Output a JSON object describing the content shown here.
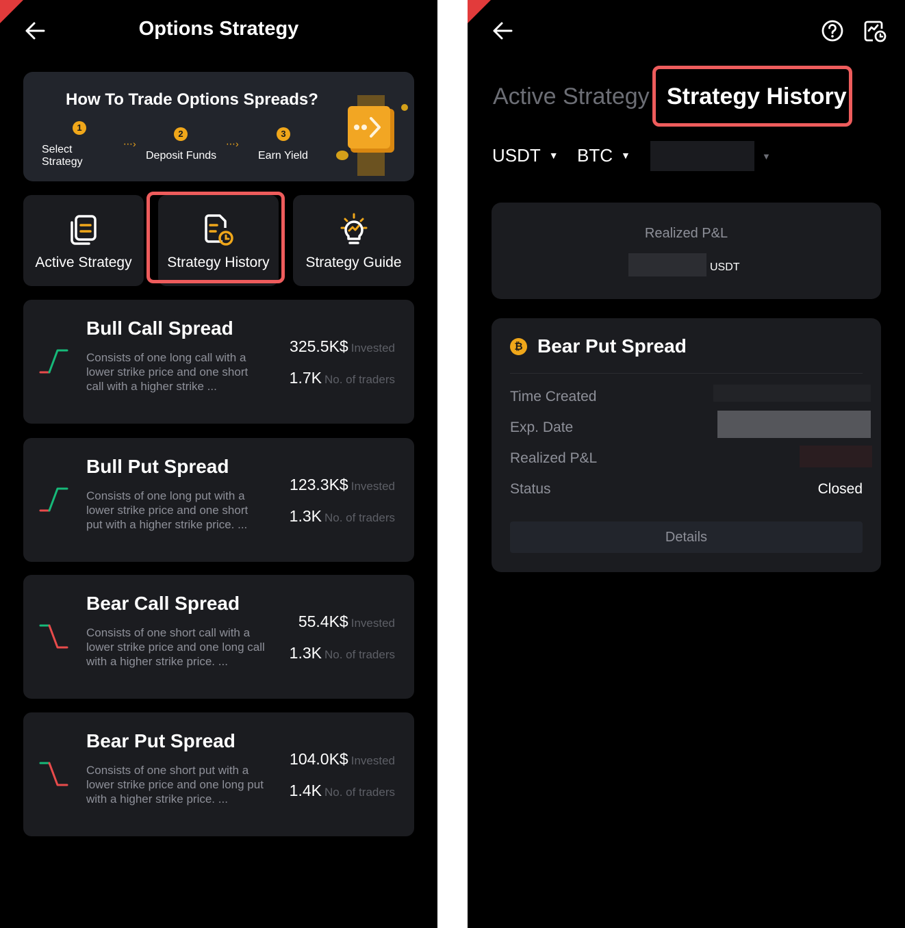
{
  "left_screen": {
    "title": "Options Strategy",
    "banner": {
      "title": "How To Trade Options Spreads?",
      "steps": [
        {
          "number": "1",
          "label": "Select Strategy"
        },
        {
          "number": "2",
          "label": "Deposit Funds"
        },
        {
          "number": "3",
          "label": "Earn Yield"
        }
      ]
    },
    "tiles": [
      {
        "label": "Active Strategy"
      },
      {
        "label": "Strategy History"
      },
      {
        "label": "Strategy Guide"
      }
    ],
    "strategies": [
      {
        "name": "Bull Call Spread",
        "description": "Consists of one long call with a lower strike price and one short call with a higher strike ...",
        "invested": "325.5K$",
        "invested_label": "Invested",
        "traders": "1.7K",
        "traders_label": "No. of traders",
        "trend": "bull"
      },
      {
        "name": "Bull Put Spread",
        "description": "Consists of one long put with a lower strike price and one short put with a higher strike price. ...",
        "invested": "123.3K$",
        "invested_label": "Invested",
        "traders": "1.3K",
        "traders_label": "No. of traders",
        "trend": "bull"
      },
      {
        "name": "Bear Call Spread",
        "description": "Consists of one short call with a lower strike price and one long call with a higher strike price. ...",
        "invested": "55.4K$",
        "invested_label": "Invested",
        "traders": "1.3K",
        "traders_label": "No. of traders",
        "trend": "bear"
      },
      {
        "name": "Bear Put Spread",
        "description": "Consists of one short put with a lower strike price and one long put with a higher strike price. ...",
        "invested": "104.0K$",
        "invested_label": "Invested",
        "traders": "1.4K",
        "traders_label": "No. of traders",
        "trend": "bear"
      }
    ]
  },
  "right_screen": {
    "tabs": {
      "inactive": "Active Strategy",
      "active": "Strategy History"
    },
    "filters": {
      "currency": "USDT",
      "coin": "BTC"
    },
    "summary": {
      "label": "Realized P&L",
      "unit": "USDT"
    },
    "position": {
      "coin_symbol": "₿",
      "name": "Bear Put Spread",
      "rows": {
        "time_created": "Time Created",
        "exp_date": "Exp. Date",
        "realized_pnl": "Realized P&L",
        "status": "Status"
      },
      "status_value": "Closed",
      "details_label": "Details"
    }
  },
  "colors": {
    "background": "#000000",
    "card": "#1b1c20",
    "accent": "#f0a71a",
    "highlight": "#ee5c5c",
    "bull_green": "#16b979",
    "bear_red": "#e84b4b"
  }
}
